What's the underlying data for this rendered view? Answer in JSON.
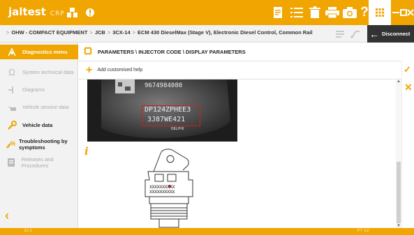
{
  "app": {
    "logo": "jaltest",
    "logo_sub": "CRP",
    "accent": "#f0a500"
  },
  "toolbar": {
    "icons": [
      "company-icon",
      "warning-icon",
      "document-icon",
      "list-icon",
      "trash-icon",
      "printer-icon",
      "camera-icon",
      "help-icon",
      "apps-grid-icon",
      "minimize-icon",
      "maximize-icon",
      "close-icon"
    ]
  },
  "breadcrumb": {
    "items": [
      "OHW - COMPACT EQUIPMENT",
      "JCB",
      "3CX-14",
      "ECM 430 DieselMax (Stage V), Electronic Diesel Control, Common Rail"
    ]
  },
  "disconnect": {
    "label": "Disconnect"
  },
  "sidebar": {
    "items": [
      {
        "label": "Diagnostics menu",
        "state": "active",
        "icon": "diagnostics-icon"
      },
      {
        "label": "System technical data",
        "state": "dim",
        "icon": "omega-icon"
      },
      {
        "label": "Diagrams",
        "state": "dim",
        "icon": "diagram-icon"
      },
      {
        "label": "Vehicle service data",
        "state": "dim",
        "icon": "oil-can-icon"
      },
      {
        "label": "Vehicle data",
        "state": "bold",
        "icon": "wrench-icon"
      },
      {
        "label": "Troubleshooting by symptoms",
        "state": "bold",
        "icon": "troubleshooting-icon"
      },
      {
        "label": "Releases and Procedures",
        "state": "dim",
        "icon": "releases-icon"
      }
    ]
  },
  "main": {
    "title": "PARAMETERS \\ INJECTOR CODE \\ DISPLAY PARAMETERS",
    "help_label": "Add customised help",
    "photo_text": {
      "line1": "9674984080",
      "line2": "DP124ZPHEE3",
      "line3": "3J87WE421",
      "brand": "DELPHI"
    },
    "diagram_text": {
      "line1": "XXXXXXXXXX",
      "line2": "XXXXXXXXXX"
    }
  },
  "statusbar": {
    "version": "22.1",
    "right": "PT 12:"
  }
}
